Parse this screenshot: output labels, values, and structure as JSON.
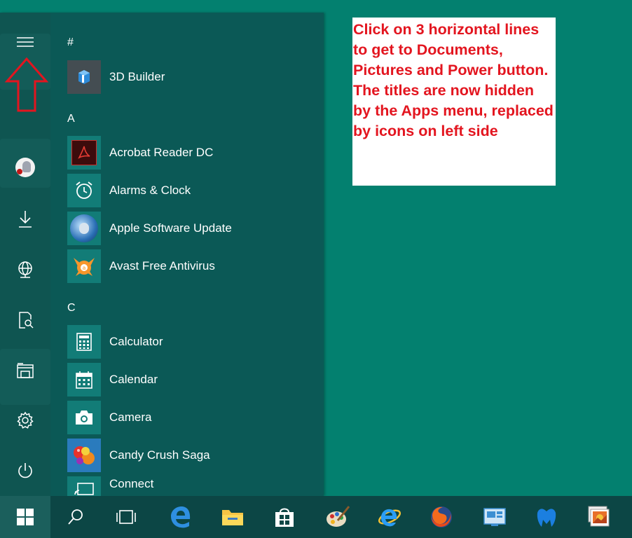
{
  "note": {
    "text": "Click on 3 horizontal lines to get to Documents, Pictures and Power button. The titles are now hidden by the Apps menu, replaced by icons on left side",
    "color": "#e3151f"
  },
  "start_menu": {
    "rail": [
      {
        "name": "menu-icon"
      },
      {
        "name": "user-avatar"
      },
      {
        "name": "downloads-icon"
      },
      {
        "name": "network-icon"
      },
      {
        "name": "documents-icon"
      },
      {
        "name": "file-explorer-icon"
      },
      {
        "name": "settings-icon"
      },
      {
        "name": "power-icon"
      }
    ],
    "groups": [
      {
        "letter": "#",
        "apps": [
          {
            "label": "3D Builder",
            "icon": "3d-builder-icon"
          }
        ]
      },
      {
        "letter": "A",
        "apps": [
          {
            "label": "Acrobat Reader DC",
            "icon": "acrobat-icon"
          },
          {
            "label": "Alarms & Clock",
            "icon": "alarm-clock-icon"
          },
          {
            "label": "Apple Software Update",
            "icon": "apple-update-icon"
          },
          {
            "label": "Avast Free Antivirus",
            "icon": "avast-icon"
          }
        ]
      },
      {
        "letter": "C",
        "apps": [
          {
            "label": "Calculator",
            "icon": "calculator-icon"
          },
          {
            "label": "Calendar",
            "icon": "calendar-icon"
          },
          {
            "label": "Camera",
            "icon": "camera-icon"
          },
          {
            "label": "Candy Crush Saga",
            "icon": "candy-crush-icon"
          },
          {
            "label": "Connect",
            "icon": "connect-icon"
          }
        ]
      }
    ]
  },
  "taskbar": {
    "items": [
      "start-button",
      "search",
      "task-view",
      "edge",
      "file-explorer",
      "store",
      "paint",
      "internet-explorer",
      "firefox",
      "remote-desktop",
      "malwarebytes",
      "photo-viewer"
    ]
  },
  "colors": {
    "desktop": "#03806f",
    "start_menu": "#0b5956",
    "taskbar": "#0c4645",
    "tile": "#127c77"
  }
}
